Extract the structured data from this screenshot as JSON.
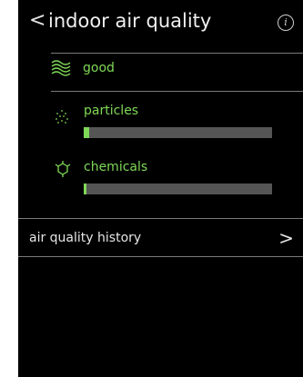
{
  "header": {
    "back_icon": "chevron-left-icon",
    "title": "indoor air quality",
    "info_icon": "info-icon"
  },
  "status": {
    "icon": "waves-icon",
    "text": "good"
  },
  "metrics": [
    {
      "label": "particles",
      "icon": "particles-dots-icon",
      "level_percent": 3
    },
    {
      "label": "chemicals",
      "icon": "molecule-icon",
      "level_percent": 1.5
    }
  ],
  "history": {
    "label": "air quality history",
    "chevron_icon": "chevron-right-icon"
  },
  "colors": {
    "accent": "#7ed957",
    "background": "#000000",
    "bar_track": "#555555",
    "divider": "#7a7a7a"
  }
}
